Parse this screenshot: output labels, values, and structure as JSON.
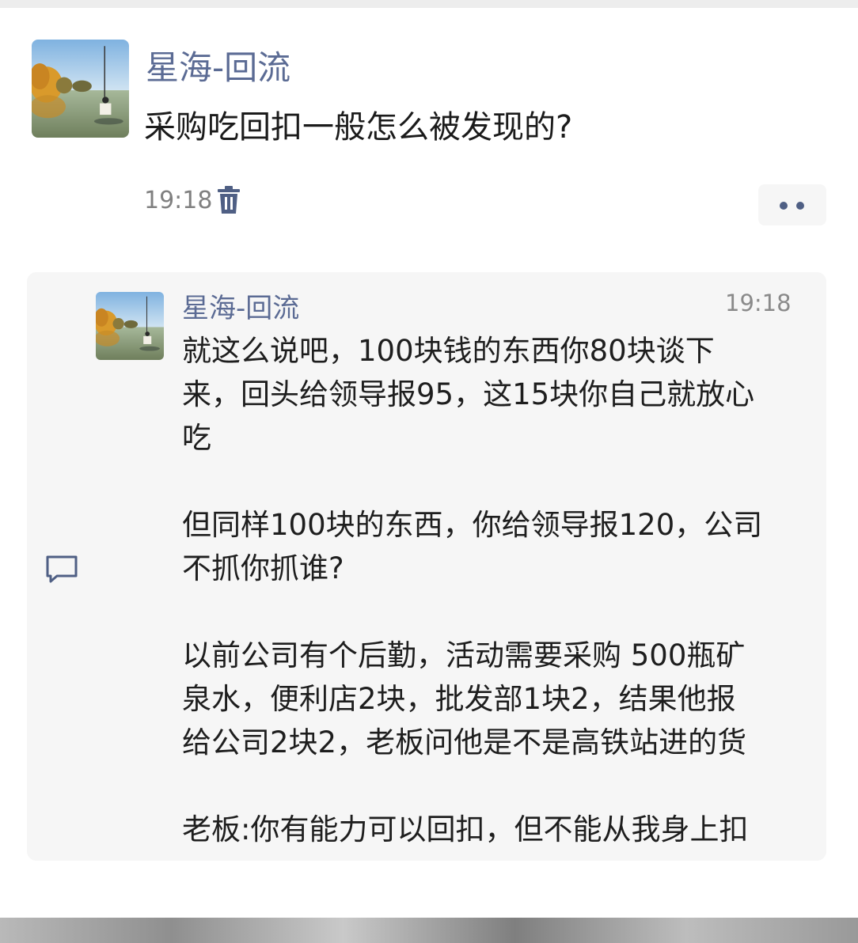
{
  "post": {
    "author": "星海-回流",
    "text": "采购吃回扣一般怎么被发现的?",
    "time": "19:18",
    "avatar_icon": "landscape-lake-avatar-icon",
    "delete_icon": "trash-icon",
    "more_icon": "more-dots-icon"
  },
  "comment": {
    "author": "星海-回流",
    "time": "19:18",
    "icon": "comment-bubble-icon",
    "paragraphs": [
      [
        "就这么说吧，100块钱的东西你80块谈下",
        "来，回头给领导报95，这15块你自己就放心",
        "吃"
      ],
      [
        "但同样100块的东西，你给领导报120，公司",
        "不抓你抓谁?"
      ],
      [
        "以前公司有个后勤，活动需要采购 500瓶矿",
        "泉水，便利店2块，批发部1块2，结果他报",
        "给公司2块2，老板问他是不是高铁站进的货"
      ],
      [
        "老板:你有能力可以回扣，但不能从我身上扣"
      ]
    ]
  },
  "colors": {
    "name": "#5b6b94",
    "text": "#1e1e1e",
    "meta": "#808080",
    "comment_bg": "#f6f6f6"
  }
}
